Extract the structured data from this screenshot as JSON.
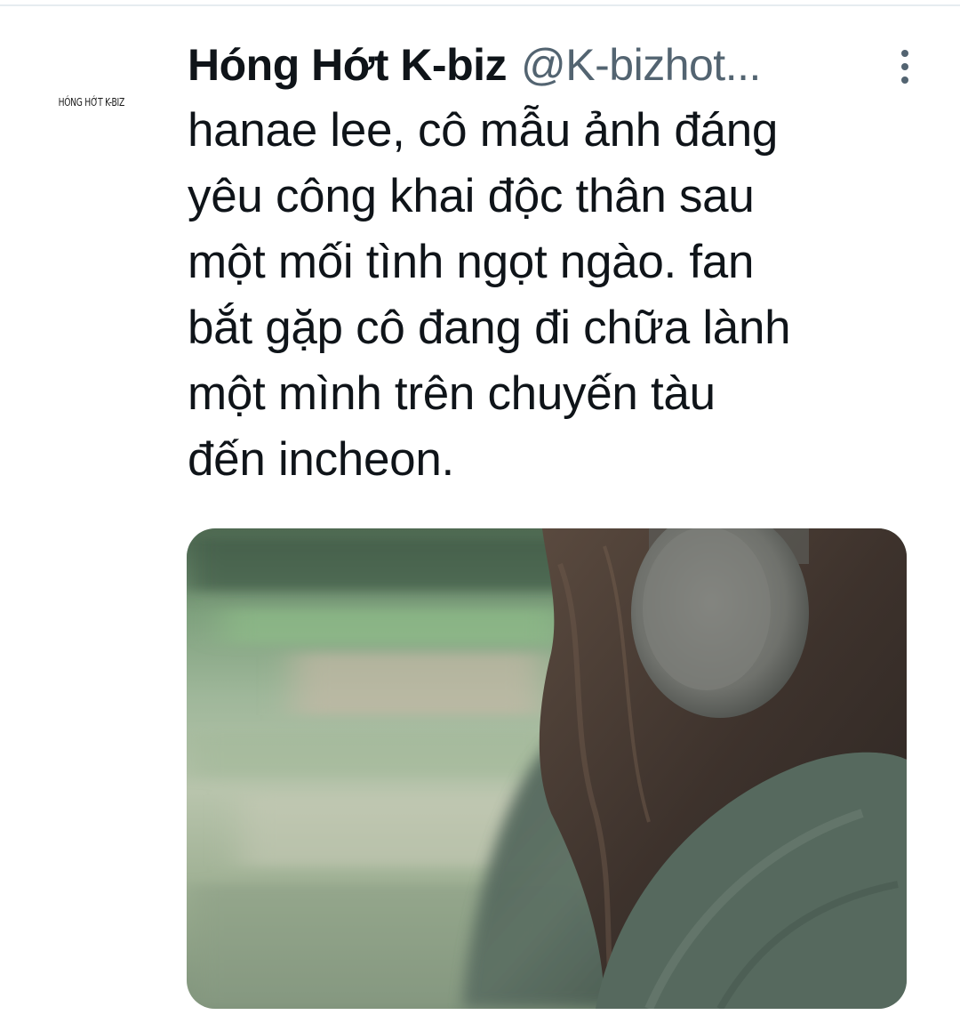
{
  "tweet": {
    "avatar_logo_text": "HÓNG HỚT K-BIZ",
    "display_name": "Hóng Hớt K-biz",
    "handle": "@K-bizhot...",
    "text": "hanae lee, cô mẫu ảnh đáng\nyêu công khai độc thân sau\nmột mối tình ngọt ngào. fan\nbắt gặp cô đang đi chữa lành\nmột mình trên chuyến tàu\nđến incheon.",
    "more_icon": "more-vertical-icon",
    "media_description_icon": "photo"
  },
  "colors": {
    "text_primary": "#0f1419",
    "text_secondary": "#536471",
    "divider": "#e6ecf0"
  }
}
